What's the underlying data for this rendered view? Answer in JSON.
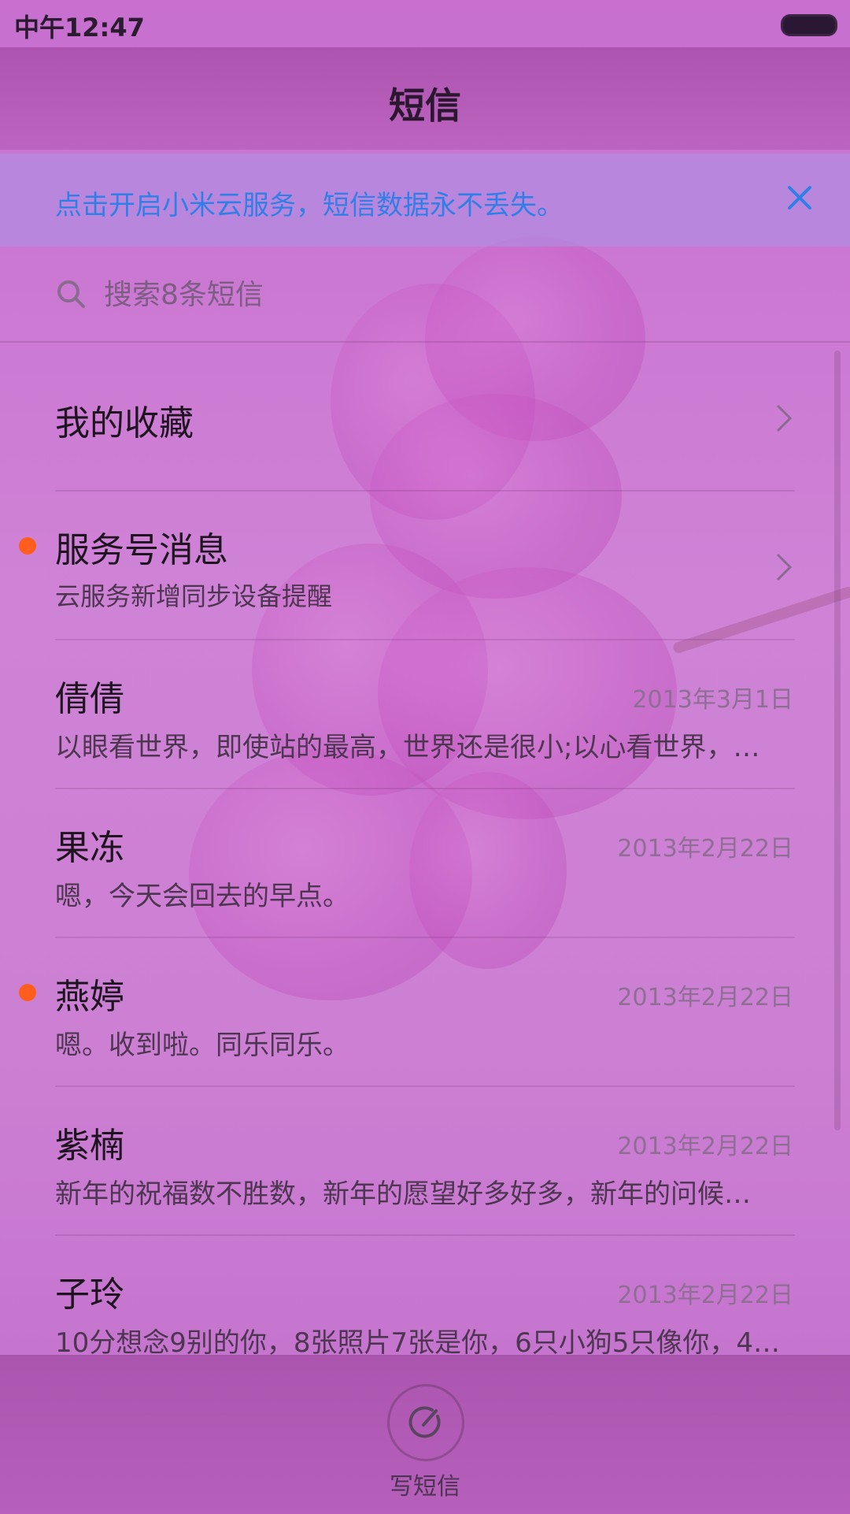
{
  "status_bar": {
    "time": "中午12:47"
  },
  "header": {
    "title": "短信"
  },
  "banner": {
    "text": "点击开启小米云服务，短信数据永不丢失。",
    "icon": "close-icon"
  },
  "search": {
    "placeholder": "搜索8条短信",
    "icon": "search-icon"
  },
  "favorites": {
    "label": "我的收藏"
  },
  "service": {
    "label": "服务号消息",
    "subtitle": "云服务新增同步设备提醒"
  },
  "conversations": [
    {
      "name": "倩倩",
      "date": "2013年3月1日",
      "preview": "以眼看世界，即使站的最高，世界还是很小;以心看世界，…"
    },
    {
      "name": "果冻",
      "date": "2013年2月22日",
      "preview": "嗯，今天会回去的早点。"
    },
    {
      "name": "燕婷",
      "date": "2013年2月22日",
      "preview": "嗯。收到啦。同乐同乐。"
    },
    {
      "name": "紫楠",
      "date": "2013年2月22日",
      "preview": "新年的祝福数不胜数，新年的愿望好多好多，新年的问候…"
    },
    {
      "name": "子玲",
      "date": "2013年2月22日",
      "preview": "10分想念9别的你，8张照片7张是你，6只小狗5只像你，4…"
    }
  ],
  "footer": {
    "compose_label": "写短信",
    "icon": "compose-icon"
  },
  "colors": {
    "accent": "#2f7fe6",
    "unread_dot": "#ff5e1e"
  }
}
